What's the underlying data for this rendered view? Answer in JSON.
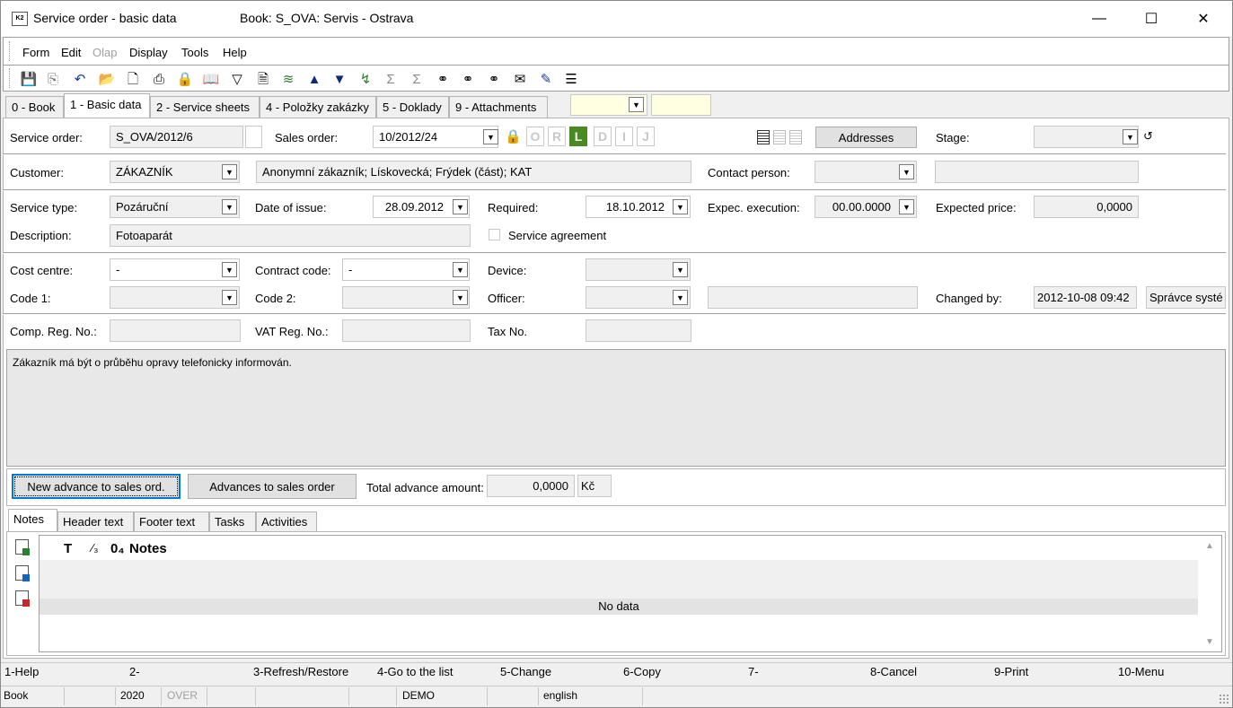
{
  "window": {
    "title": "Service order - basic data",
    "book_title": "Book: S_OVA: Servis - Ostrava",
    "minimize": "—",
    "maximize": "☐",
    "close": "✕"
  },
  "menu": [
    "Form",
    "Edit",
    "Olap",
    "Display",
    "Tools",
    "Help"
  ],
  "tabs": [
    "0 - Book",
    "1 - Basic data",
    "2 - Service sheets",
    "4 - Položky zakázky",
    "5 - Doklady",
    "9 - Attachments"
  ],
  "form": {
    "service_order_label": "Service order:",
    "service_order_value": "S_OVA/2012/6",
    "sales_order_label": "Sales order:",
    "sales_order_value": "10/2012/24",
    "flags": [
      "O",
      "R",
      "L",
      "D",
      "I",
      "J"
    ],
    "addresses_button": "Addresses",
    "stage_label": "Stage:",
    "stage_value": "",
    "customer_label": "Customer:",
    "customer_value": "ZÁKAZNÍK",
    "customer_address": "Anonymní zákazník; Lískovecká; Frýdek (část); KAT",
    "contact_person_label": "Contact person:",
    "contact_person_value": "",
    "service_type_label": "Service type:",
    "service_type_value": "Pozáruční",
    "date_of_issue_label": "Date of issue:",
    "date_of_issue_value": "28.09.2012",
    "required_label": "Required:",
    "required_value": "18.10.2012",
    "expec_execution_label": "Expec. execution:",
    "expec_execution_value": "00.00.0000",
    "expected_price_label": "Expected price:",
    "expected_price_value": "0,0000",
    "description_label": "Description:",
    "description_value": "Fotoaparát",
    "service_agreement_label": "Service agreement",
    "cost_centre_label": "Cost centre:",
    "cost_centre_value": "-",
    "contract_code_label": "Contract code:",
    "contract_code_value": "-",
    "device_label": "Device:",
    "code1_label": "Code 1:",
    "code2_label": "Code 2:",
    "officer_label": "Officer:",
    "changed_by_label": "Changed by:",
    "changed_by_date": "2012-10-08 09:42",
    "changed_by_user": "Správce systé",
    "comp_reg_label": "Comp. Reg. No.:",
    "vat_reg_label": "VAT Reg. No.:",
    "tax_no_label": "Tax No.",
    "note_text": "Zákazník má být o průběhu opravy telefonicky informován."
  },
  "advance": {
    "new_button": "New advance to sales ord.",
    "list_button": "Advances to sales order",
    "total_label": "Total advance amount:",
    "total_value": "0,0000",
    "currency": "Kč"
  },
  "bottom_tabs": [
    "Notes",
    "Header text",
    "Footer text",
    "Tasks",
    "Activities"
  ],
  "notes_grid": {
    "col_t": "T",
    "col_3": "⁄₃",
    "col_4": "0₄",
    "col_notes": "Notes",
    "empty": "No data"
  },
  "fkeys": [
    "1-Help",
    "2-",
    "3-Refresh/Restore",
    "4-Go to the list",
    "5-Change",
    "6-Copy",
    "7-",
    "8-Cancel",
    "9-Print",
    "10-Menu"
  ],
  "statusbar": {
    "book": "Book",
    "year": "2020",
    "over": "OVER",
    "demo": "DEMO",
    "language": "english"
  },
  "colors": {
    "flag_active": "#4a8a22",
    "lock": "#4caf50",
    "focus_border": "#0078d7"
  }
}
